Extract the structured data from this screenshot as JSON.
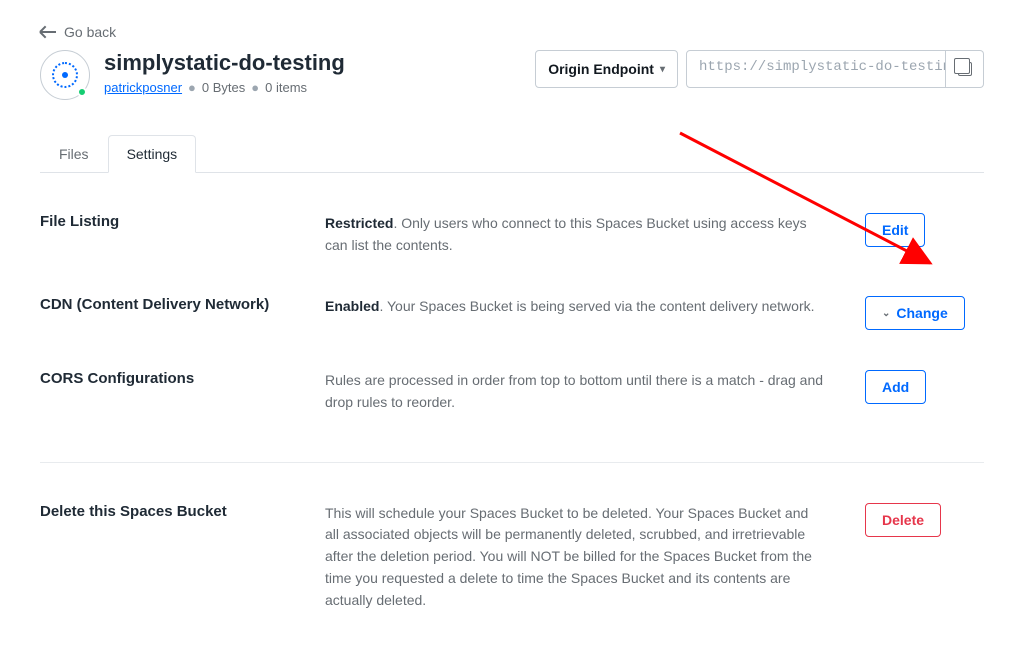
{
  "nav": {
    "go_back": "Go back"
  },
  "header": {
    "title": "simplystatic-do-testing",
    "owner": "patrickposner",
    "size": "0 Bytes",
    "items": "0 items"
  },
  "endpoint": {
    "selector_label": "Origin Endpoint",
    "url": "https://simplystatic-do-testing.fra"
  },
  "tabs": {
    "files": "Files",
    "settings": "Settings"
  },
  "settings": {
    "file_listing": {
      "label": "File Listing",
      "status": "Restricted",
      "desc_rest": ". Only users who connect to this Spaces Bucket using access keys can list the contents.",
      "action": "Edit"
    },
    "cdn": {
      "label": "CDN (Content Delivery Network)",
      "status": "Enabled",
      "desc_rest": ". Your Spaces Bucket is being served via the content delivery network.",
      "action": "Change"
    },
    "cors": {
      "label": "CORS Configurations",
      "desc": "Rules are processed in order from top to bottom until there is a match - drag and drop rules to reorder.",
      "action": "Add"
    },
    "delete": {
      "label": "Delete this Spaces Bucket",
      "desc": "This will schedule your Spaces Bucket to be deleted. Your Spaces Bucket and all associated objects will be permanently deleted, scrubbed, and irretrievable after the deletion period. You will NOT be billed for the Spaces Bucket from the time you requested a delete to time the Spaces Bucket and its contents are actually deleted.",
      "action": "Delete"
    }
  }
}
